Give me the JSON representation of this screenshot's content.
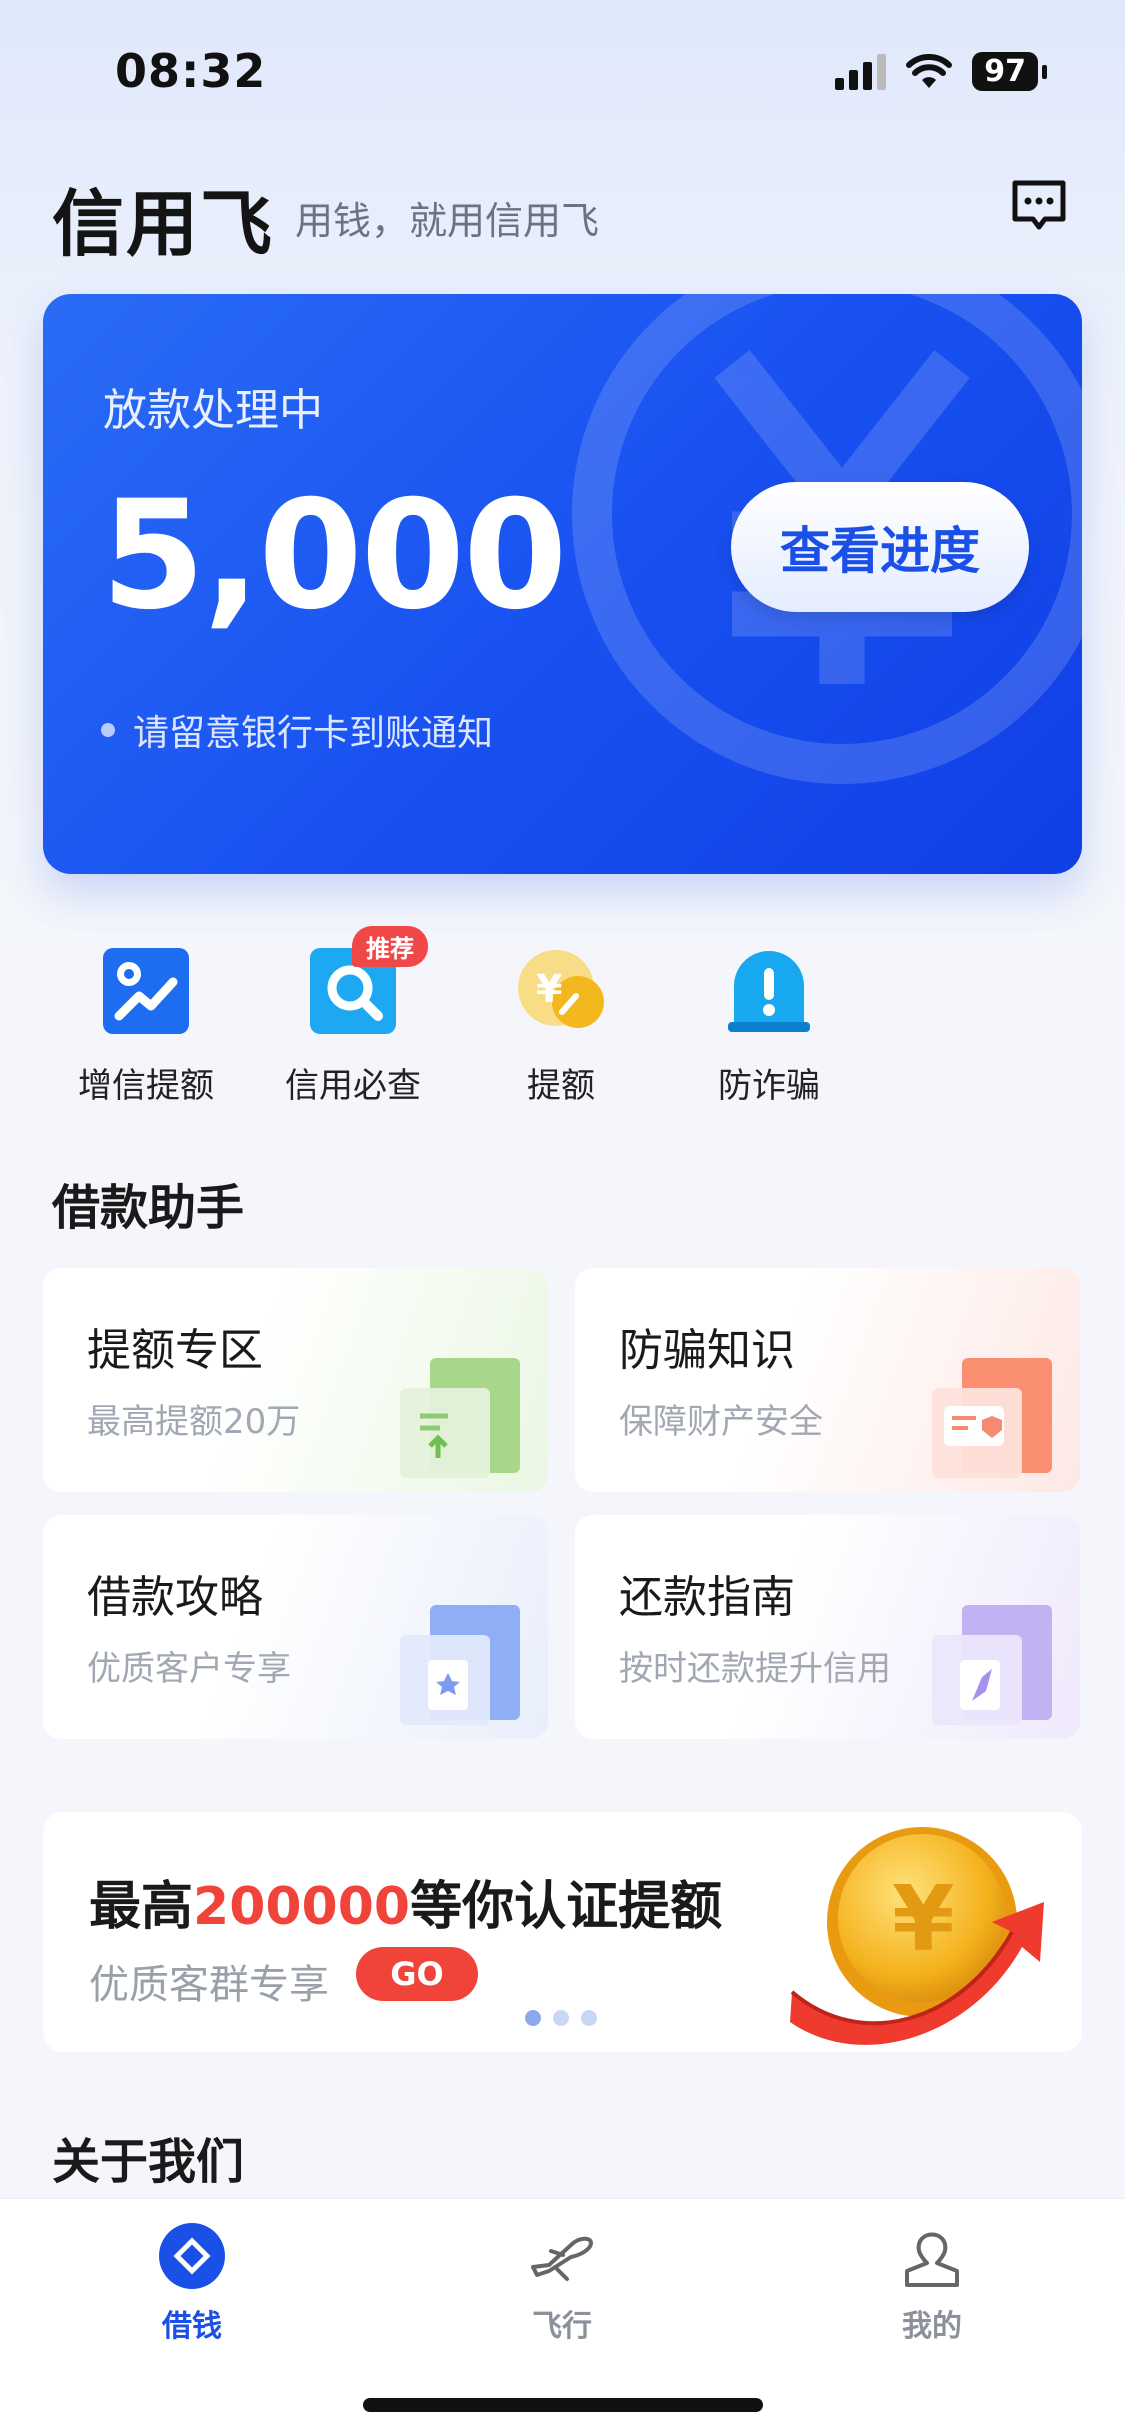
{
  "status": {
    "time": "08:32",
    "battery": "97"
  },
  "header": {
    "brand": "信用飞",
    "slogan": "用钱，就用信用飞"
  },
  "loan_card": {
    "status": "放款处理中",
    "amount": "5,000",
    "progress_button": "查看进度",
    "note": "请留意银行卡到账通知"
  },
  "quick_actions": [
    {
      "label": "增信提额"
    },
    {
      "label": "信用必查",
      "badge": "推荐"
    },
    {
      "label": "提额"
    },
    {
      "label": "防诈骗"
    }
  ],
  "helper": {
    "title": "借款助手",
    "cards": [
      {
        "title": "提额专区",
        "subtitle": "最高提额20万"
      },
      {
        "title": "防骗知识",
        "subtitle": "保障财产安全"
      },
      {
        "title": "借款攻略",
        "subtitle": "优质客户专享"
      },
      {
        "title": "还款指南",
        "subtitle": "按时还款提升信用"
      }
    ]
  },
  "promo": {
    "title_prefix": "最高",
    "title_highlight": "200000",
    "title_suffix": "等你认证提额",
    "subtitle": "优质客群专享",
    "button": "GO",
    "page_count": 3,
    "current_page": 1
  },
  "about": {
    "title": "关于我们"
  },
  "tabbar": {
    "items": [
      {
        "label": "借钱",
        "icon": "diamond-icon",
        "active": true
      },
      {
        "label": "飞行",
        "icon": "plane-icon",
        "active": false
      },
      {
        "label": "我的",
        "icon": "person-icon",
        "active": false
      }
    ]
  },
  "colors": {
    "primary": "#1a4fe8",
    "accent_red": "#f0443a"
  }
}
